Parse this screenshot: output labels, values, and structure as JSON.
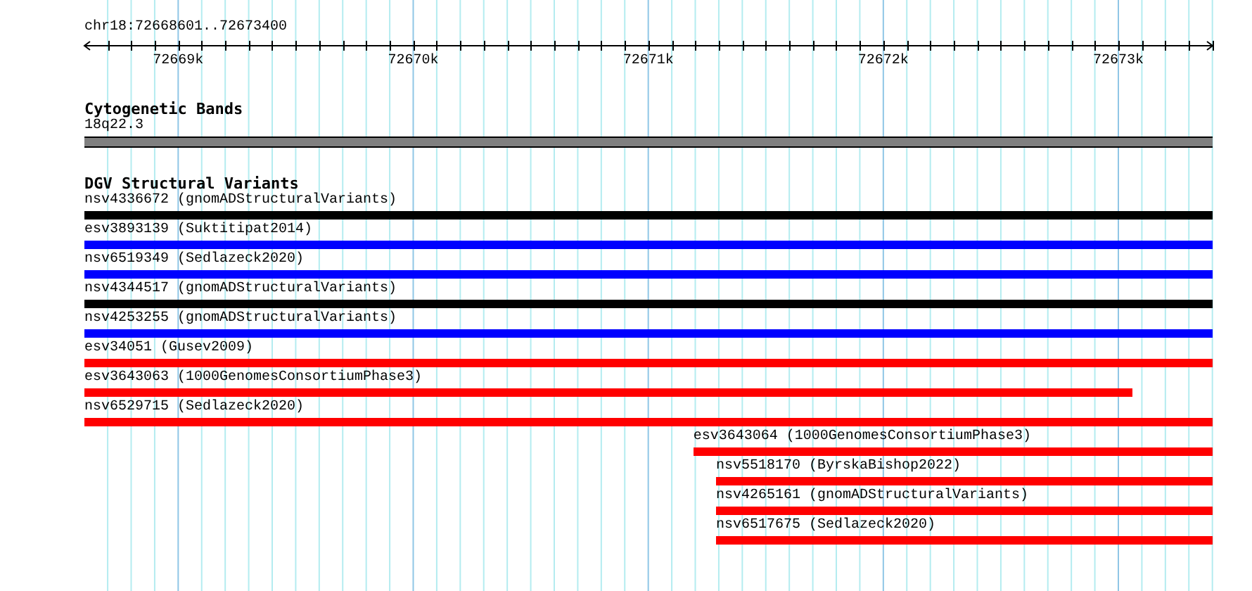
{
  "ruler": {
    "location": "chr18:72668601..72673400",
    "ticks": [
      {
        "label": "72669k"
      },
      {
        "label": "72670k"
      },
      {
        "label": "72671k"
      },
      {
        "label": "72672k"
      },
      {
        "label": "72673k"
      }
    ]
  },
  "cytoband_track": {
    "title": "Cytogenetic Bands",
    "band": {
      "name": "18q22.3"
    }
  },
  "variant_track": {
    "title": "DGV Structural Variants",
    "features": [
      {
        "label": "nsv4336672 (gnomADStructuralVariants)",
        "color": "#000000"
      },
      {
        "label": "esv3893139 (Suktitipat2014)",
        "color": "#0000ff"
      },
      {
        "label": "nsv6519349 (Sedlazeck2020)",
        "color": "#0000ff"
      },
      {
        "label": "nsv4344517 (gnomADStructuralVariants)",
        "color": "#000000"
      },
      {
        "label": "nsv4253255 (gnomADStructuralVariants)",
        "color": "#0000ff"
      },
      {
        "label": "esv34051 (Gusev2009)",
        "color": "#ff0000"
      },
      {
        "label": "esv3643063 (1000GenomesConsortiumPhase3)",
        "color": "#ff0000"
      },
      {
        "label": "nsv6529715 (Sedlazeck2020)",
        "color": "#ff0000"
      },
      {
        "label": "esv3643064 (1000GenomesConsortiumPhase3)",
        "color": "#ff0000"
      },
      {
        "label": "nsv5518170 (ByrskaBishop2022)",
        "color": "#ff0000"
      },
      {
        "label": "nsv4265161 (gnomADStructuralVariants)",
        "color": "#ff0000"
      },
      {
        "label": "nsv6517675 (Sedlazeck2020)",
        "color": "#ff0000"
      }
    ]
  }
}
